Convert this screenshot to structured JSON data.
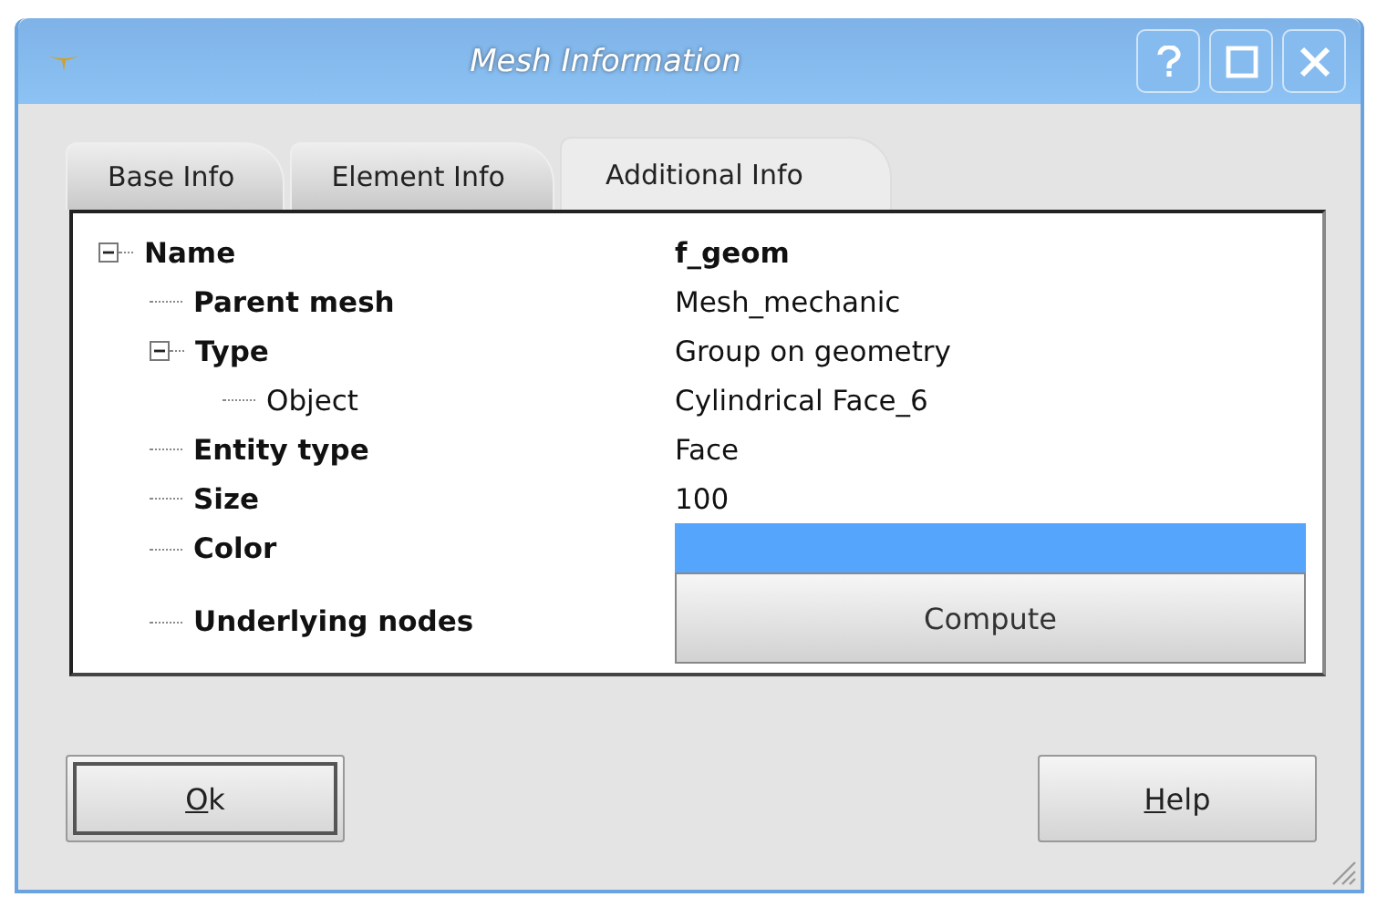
{
  "window": {
    "title": "Mesh Information",
    "controls": [
      {
        "kind": "help"
      },
      {
        "kind": "maximize"
      },
      {
        "kind": "close"
      }
    ]
  },
  "tabs": [
    {
      "label": "Base Info",
      "selected": false
    },
    {
      "label": "Element Info",
      "selected": false
    },
    {
      "label": "Additional Info",
      "selected": true
    }
  ],
  "tree": [
    {
      "label": "Name",
      "bold": true,
      "expanded": true,
      "value": {
        "kind": "text",
        "text": "f_geom",
        "bold": true
      },
      "children": [
        {
          "label": "Parent mesh",
          "bold": true,
          "value": {
            "kind": "text",
            "text": "Mesh_mechanic"
          }
        },
        {
          "label": "Type",
          "bold": true,
          "expanded": true,
          "value": {
            "kind": "text",
            "text": "Group on geometry"
          },
          "children": [
            {
              "label": "Object",
              "bold": false,
              "value": {
                "kind": "text",
                "text": "Cylindrical Face_6"
              }
            }
          ]
        },
        {
          "label": "Entity type",
          "bold": true,
          "value": {
            "kind": "text",
            "text": "Face"
          }
        },
        {
          "label": "Size",
          "bold": true,
          "value": {
            "kind": "text",
            "text": "100"
          }
        },
        {
          "label": "Color",
          "bold": true,
          "value": {
            "kind": "color",
            "color": "#55a5fc"
          }
        },
        {
          "label": "Underlying nodes",
          "bold": true,
          "value": {
            "kind": "button",
            "text": "Compute"
          }
        }
      ]
    }
  ],
  "buttons": [
    {
      "label": "Ok",
      "mnemonic_underlined": true,
      "default": true
    },
    {
      "label": "Help",
      "mnemonic_underlined": true,
      "default": false
    }
  ]
}
